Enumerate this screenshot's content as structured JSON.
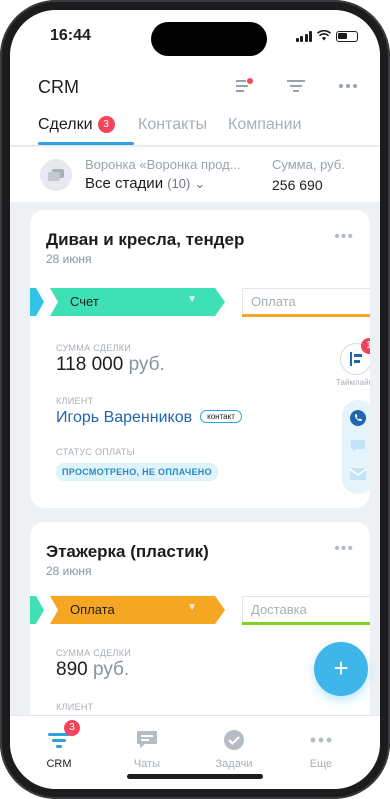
{
  "status_bar": {
    "time": "16:44"
  },
  "header": {
    "title": "CRM"
  },
  "tabs": [
    {
      "label": "Сделки",
      "badge": "3",
      "active": true
    },
    {
      "label": "Контакты",
      "active": false
    },
    {
      "label": "Компании",
      "active": false
    }
  ],
  "funnel": {
    "label": "Воронка «Воронка прод...",
    "stage": "Все стадии",
    "count": "(10)",
    "sum_label": "Сумма, руб.",
    "sum_value": "256 690"
  },
  "deals": [
    {
      "title": "Диван и кресла, тендер",
      "date": "28 июня",
      "stage_current": "Счет",
      "stage_current_color": "#3fe0b5",
      "stage_next": "Оплата",
      "stage_next_color": "#f5a623",
      "amount_label": "СУММА СДЕЛКИ",
      "amount": "118 000",
      "currency": "руб.",
      "client_label": "КЛИЕНТ",
      "client_name": "Игорь Варенников",
      "client_tag": "контакт",
      "payment_label": "СТАТУС ОПЛАТЫ",
      "payment_status": "ПРОСМОТРЕНО, НЕ ОПЛАЧЕНО",
      "timeline_label": "Таймлайн",
      "timeline_badge": "1"
    },
    {
      "title": "Этажерка (пластик)",
      "date": "28 июня",
      "stage_current": "Оплата",
      "stage_current_color": "#f5a623",
      "stage_next": "Доставка",
      "stage_next_color": "#7ed321",
      "amount_label": "СУММА СДЕЛКИ",
      "amount": "890",
      "currency": "руб.",
      "client_label": "КЛИЕНТ"
    }
  ],
  "fab": {
    "label": "+"
  },
  "bottom_nav": [
    {
      "label": "CRM",
      "icon": "crm-funnel-icon",
      "badge": "3",
      "active": true
    },
    {
      "label": "Чаты",
      "icon": "chat-icon",
      "active": false
    },
    {
      "label": "Задачи",
      "icon": "tasks-check-icon",
      "active": false
    },
    {
      "label": "Еще",
      "icon": "more-dots-icon",
      "active": false
    }
  ],
  "colors": {
    "accent": "#2fa0e0",
    "badge": "#f2445b",
    "fab": "#3fb6ea",
    "link": "#2067b0"
  }
}
